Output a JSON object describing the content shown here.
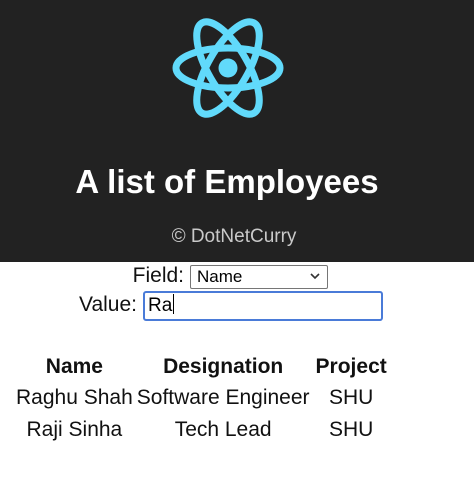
{
  "header": {
    "logo_icon": "react-logo-icon",
    "title": "A list of Employees",
    "copyright": "© DotNetCurry",
    "background": "#222222",
    "logo_color": "#61dafb"
  },
  "filter": {
    "field_label": "Field:",
    "field_selected": "Name",
    "value_label": "Value:",
    "value_text": "Ra",
    "focus_color": "#4a7bd8"
  },
  "table": {
    "headers": [
      "Name",
      "Designation",
      "Project"
    ],
    "rows": [
      [
        "Raghu Shah",
        "Software Engineer",
        "SHU"
      ],
      [
        "Raji Sinha",
        "Tech Lead",
        "SHU"
      ]
    ]
  }
}
